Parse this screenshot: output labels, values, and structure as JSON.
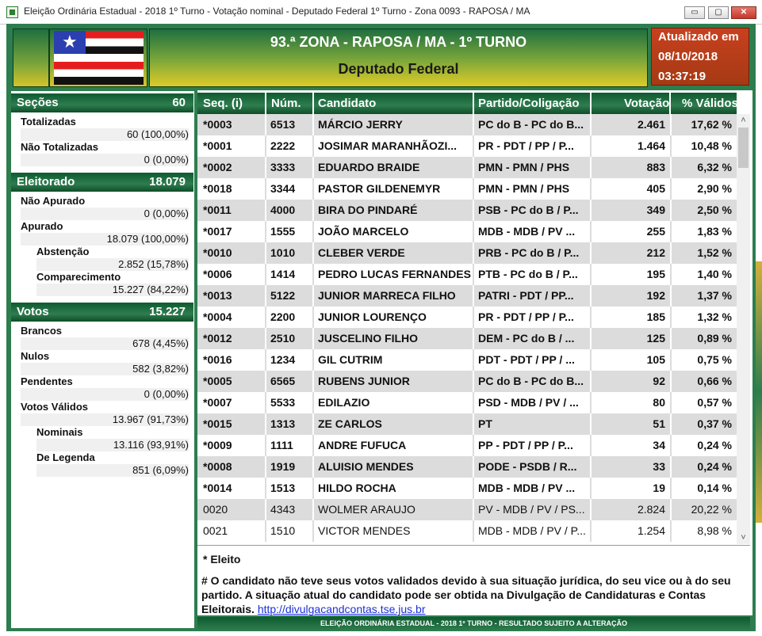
{
  "window": {
    "title": "Eleição Ordinária Estadual - 2018 1º Turno - Votação nominal - Deputado Federal 1º Turno - Zona 0093 - RAPOSA / MA",
    "minimize": "▭",
    "maximize": "▢",
    "close": "✕"
  },
  "header": {
    "title": "93.ª ZONA - RAPOSA / MA - 1º TURNO",
    "subtitle": "Deputado Federal",
    "updated_label": "Atualizado em",
    "updated_date": "08/10/2018",
    "updated_time": "03:37:19"
  },
  "sidebar": {
    "secoes": {
      "label": "Seções",
      "value": "60",
      "items": [
        {
          "label": "Totalizadas",
          "value": "60 (100,00%)"
        },
        {
          "label": "Não Totalizadas",
          "value": "0 (0,00%)"
        }
      ]
    },
    "eleitorado": {
      "label": "Eleitorado",
      "value": "18.079",
      "items": [
        {
          "label": "Não Apurado",
          "value": "0 (0,00%)"
        },
        {
          "label": "Apurado",
          "value": "18.079 (100,00%)"
        },
        {
          "label": "Abstenção",
          "value": "2.852 (15,78%)"
        },
        {
          "label": "Comparecimento",
          "value": "15.227 (84,22%)"
        }
      ]
    },
    "votos": {
      "label": "Votos",
      "value": "15.227",
      "items": [
        {
          "label": "Brancos",
          "value": "678 (4,45%)"
        },
        {
          "label": "Nulos",
          "value": "582 (3,82%)"
        },
        {
          "label": "Pendentes",
          "value": "0 (0,00%)"
        },
        {
          "label": "Votos Válidos",
          "value": "13.967 (91,73%)"
        },
        {
          "label": "Nominais",
          "value": "13.116 (93,91%)"
        },
        {
          "label": "De Legenda",
          "value": "851 (6,09%)"
        }
      ]
    }
  },
  "table": {
    "headers": [
      "Seq.   (i)",
      "Núm.",
      "Candidato",
      "Partido/Coligação",
      "Votação",
      "% Válidos"
    ],
    "rows": [
      {
        "seq": "*0003",
        "num": "6513",
        "name": "MÁRCIO JERRY",
        "party": "PC do B - PC do B...",
        "votes": "2.461",
        "pct": "17,62 %",
        "elected": true
      },
      {
        "seq": "*0001",
        "num": "2222",
        "name": "JOSIMAR MARANHÃOZI...",
        "party": "PR - PDT / PP / P...",
        "votes": "1.464",
        "pct": "10,48 %",
        "elected": true
      },
      {
        "seq": "*0002",
        "num": "3333",
        "name": "EDUARDO BRAIDE",
        "party": "PMN - PMN / PHS",
        "votes": "883",
        "pct": "6,32 %",
        "elected": true
      },
      {
        "seq": "*0018",
        "num": "3344",
        "name": "PASTOR GILDENEMYR",
        "party": "PMN - PMN / PHS",
        "votes": "405",
        "pct": "2,90 %",
        "elected": true
      },
      {
        "seq": "*0011",
        "num": "4000",
        "name": "BIRA DO PINDARÉ",
        "party": "PSB - PC do B / P...",
        "votes": "349",
        "pct": "2,50 %",
        "elected": true
      },
      {
        "seq": "*0017",
        "num": "1555",
        "name": "JOÃO MARCELO",
        "party": "MDB - MDB / PV ...",
        "votes": "255",
        "pct": "1,83 %",
        "elected": true
      },
      {
        "seq": "*0010",
        "num": "1010",
        "name": "CLEBER VERDE",
        "party": "PRB - PC do B / P...",
        "votes": "212",
        "pct": "1,52 %",
        "elected": true
      },
      {
        "seq": "*0006",
        "num": "1414",
        "name": "PEDRO LUCAS FERNANDES",
        "party": "PTB - PC do B / P...",
        "votes": "195",
        "pct": "1,40 %",
        "elected": true
      },
      {
        "seq": "*0013",
        "num": "5122",
        "name": "JUNIOR MARRECA FILHO",
        "party": "PATRI - PDT / PP...",
        "votes": "192",
        "pct": "1,37 %",
        "elected": true
      },
      {
        "seq": "*0004",
        "num": "2200",
        "name": "JUNIOR LOURENÇO",
        "party": "PR - PDT / PP / P...",
        "votes": "185",
        "pct": "1,32 %",
        "elected": true
      },
      {
        "seq": "*0012",
        "num": "2510",
        "name": "JUSCELINO FILHO",
        "party": "DEM - PC do B / ...",
        "votes": "125",
        "pct": "0,89 %",
        "elected": true
      },
      {
        "seq": "*0016",
        "num": "1234",
        "name": "GIL CUTRIM",
        "party": "PDT - PDT / PP / ...",
        "votes": "105",
        "pct": "0,75 %",
        "elected": true
      },
      {
        "seq": "*0005",
        "num": "6565",
        "name": "RUBENS JUNIOR",
        "party": "PC do B - PC do B...",
        "votes": "92",
        "pct": "0,66 %",
        "elected": true
      },
      {
        "seq": "*0007",
        "num": "5533",
        "name": "EDILAZIO",
        "party": "PSD - MDB / PV / ...",
        "votes": "80",
        "pct": "0,57 %",
        "elected": true
      },
      {
        "seq": "*0015",
        "num": "1313",
        "name": "ZE CARLOS",
        "party": "PT",
        "votes": "51",
        "pct": "0,37 %",
        "elected": true
      },
      {
        "seq": "*0009",
        "num": "1111",
        "name": "ANDRE FUFUCA",
        "party": "PP - PDT / PP / P...",
        "votes": "34",
        "pct": "0,24 %",
        "elected": true
      },
      {
        "seq": "*0008",
        "num": "1919",
        "name": "ALUISIO MENDES",
        "party": "PODE - PSDB / R...",
        "votes": "33",
        "pct": "0,24 %",
        "elected": true
      },
      {
        "seq": "*0014",
        "num": "1513",
        "name": "HILDO ROCHA",
        "party": "MDB - MDB / PV ...",
        "votes": "19",
        "pct": "0,14 %",
        "elected": true
      },
      {
        "seq": "0020",
        "num": "4343",
        "name": "WOLMER ARAUJO",
        "party": "PV - MDB / PV / PS...",
        "votes": "2.824",
        "pct": "20,22 %",
        "elected": false
      },
      {
        "seq": "0021",
        "num": "1510",
        "name": "VICTOR MENDES",
        "party": "MDB - MDB / PV / P...",
        "votes": "1.254",
        "pct": "8,98 %",
        "elected": false
      }
    ]
  },
  "notes": {
    "eleito": "* Eleito",
    "hash_text": "# O candidato não teve seus votos validados devido à sua situação jurídica, do seu vice ou à do seu partido. A situação atual do candidato pode ser obtida na Divulgação de Candidaturas e Contas Eleitorais.",
    "link": "http://divulgacandcontas.tse.jus.br"
  },
  "footer": "ELEIÇÃO ORDINÁRIA ESTADUAL - 2018 1º TURNO - RESULTADO SUJEITO A ALTERAÇÃO",
  "scroll": {
    "up": "˄",
    "down": "˅"
  },
  "flag_star": "★",
  "colors": {
    "green": "#2e7d4f",
    "dark_green": "#0f5a30",
    "yellow": "#e0cb28",
    "orange_red": "#c8401e",
    "link": "#1a2fd8"
  }
}
